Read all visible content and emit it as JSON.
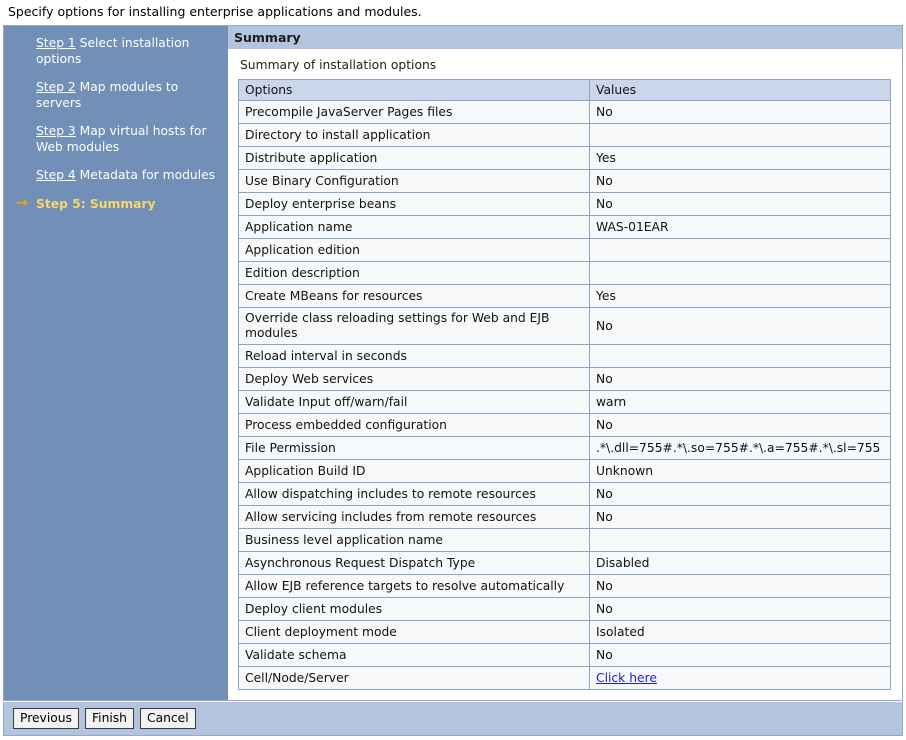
{
  "instruction": "Specify options for installing enterprise applications and modules.",
  "sidebar": {
    "steps": [
      {
        "link": "Step 1",
        "text": " Select installation options",
        "current": false
      },
      {
        "link": "Step 2",
        "text": " Map modules to servers",
        "current": false
      },
      {
        "link": "Step 3",
        "text": " Map virtual hosts for Web modules",
        "current": false
      },
      {
        "link": "Step 4",
        "text": " Metadata for modules",
        "current": false
      },
      {
        "link": "",
        "text": "Step 5: Summary",
        "current": true,
        "arrow": "→"
      }
    ]
  },
  "panel": {
    "header": "Summary",
    "subtitle": "Summary of installation options"
  },
  "table": {
    "columns": [
      "Options",
      "Values"
    ],
    "rows": [
      {
        "option": "Precompile JavaServer Pages files",
        "value": "No"
      },
      {
        "option": "Directory to install application",
        "value": ""
      },
      {
        "option": "Distribute application",
        "value": "Yes"
      },
      {
        "option": "Use Binary Configuration",
        "value": "No"
      },
      {
        "option": "Deploy enterprise beans",
        "value": "No"
      },
      {
        "option": "Application name",
        "value": "WAS-01EAR"
      },
      {
        "option": "Application edition",
        "value": ""
      },
      {
        "option": "Edition description",
        "value": ""
      },
      {
        "option": "Create MBeans for resources",
        "value": "Yes"
      },
      {
        "option": "Override class reloading settings for Web and EJB modules",
        "value": "No"
      },
      {
        "option": "Reload interval in seconds",
        "value": ""
      },
      {
        "option": "Deploy Web services",
        "value": "No"
      },
      {
        "option": "Validate Input off/warn/fail",
        "value": "warn"
      },
      {
        "option": "Process embedded configuration",
        "value": "No"
      },
      {
        "option": "File Permission",
        "value": ".*\\.dll=755#.*\\.so=755#.*\\.a=755#.*\\.sl=755"
      },
      {
        "option": "Application Build ID",
        "value": "Unknown"
      },
      {
        "option": "Allow dispatching includes to remote resources",
        "value": "No"
      },
      {
        "option": "Allow servicing includes from remote resources",
        "value": "No"
      },
      {
        "option": "Business level application name",
        "value": ""
      },
      {
        "option": "Asynchronous Request Dispatch Type",
        "value": "Disabled"
      },
      {
        "option": "Allow EJB reference targets to resolve automatically",
        "value": "No"
      },
      {
        "option": "Deploy client modules",
        "value": "No"
      },
      {
        "option": "Client deployment mode",
        "value": "Isolated"
      },
      {
        "option": "Validate schema",
        "value": "No"
      },
      {
        "option": "Cell/Node/Server",
        "value": "Click here",
        "link": true
      }
    ]
  },
  "footer": {
    "buttons": [
      "Previous",
      "Finish",
      "Cancel"
    ]
  },
  "colors": {
    "sidebar_bg": "#7290b7",
    "panel_header_bg": "#b3c4de",
    "table_header_bg": "#cbd6ea",
    "table_row_bg": "#f7f8fa",
    "table_border": "#8ba3c7",
    "current_step_text": "#f5d76e",
    "arrow": "#f0a500",
    "link": "#2020d0",
    "footer_bg": "#b5c4de"
  }
}
